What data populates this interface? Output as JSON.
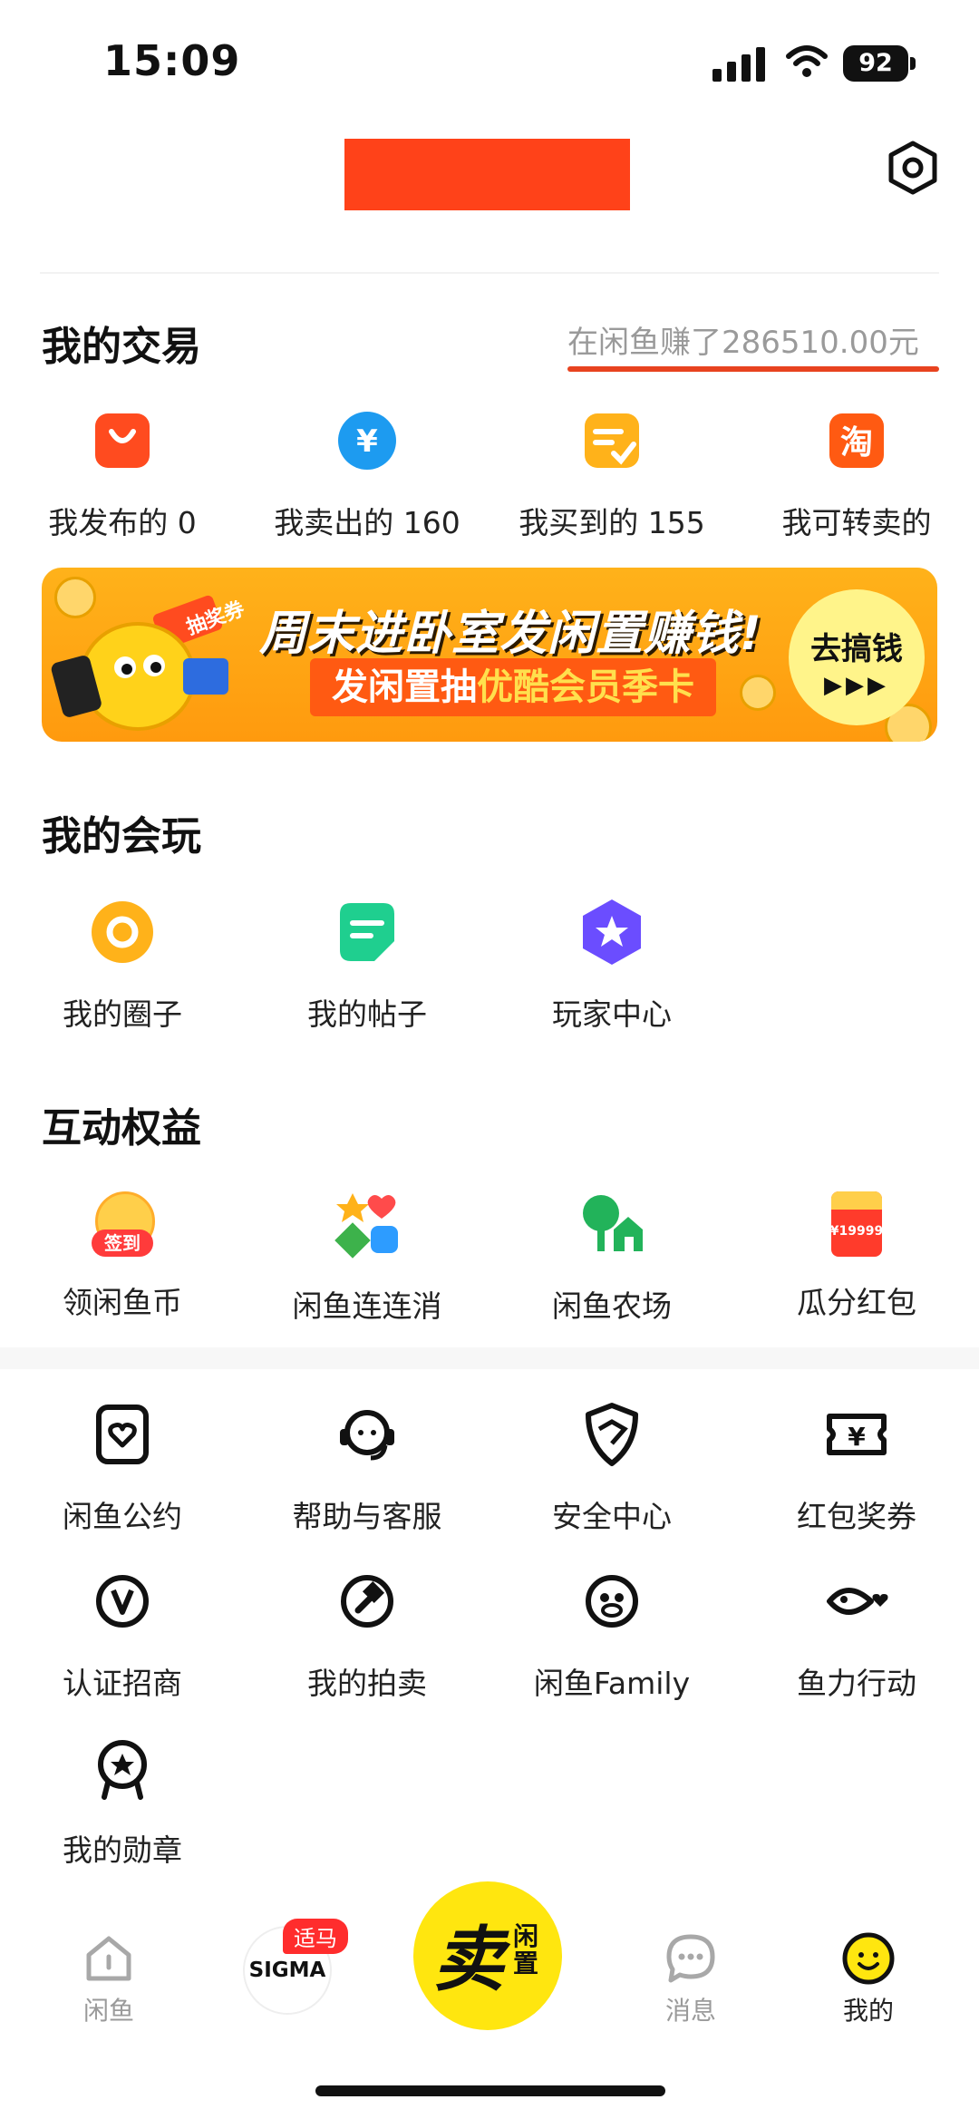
{
  "status_bar": {
    "time": "15:09",
    "battery": "92"
  },
  "settings_icon": "hexagon-settings-icon",
  "trade": {
    "title": "我的交易",
    "earned": "在闲鱼赚了286510.00元",
    "items": [
      {
        "label": "我发布的 0",
        "icon": "bag-icon",
        "color": "#ff4b1f"
      },
      {
        "label": "我卖出的 160",
        "icon": "yen-circle-icon",
        "color": "#1d9bf0"
      },
      {
        "label": "我买到的 155",
        "icon": "check-note-icon",
        "color": "#ffb21a"
      },
      {
        "label": "我可转卖的",
        "icon": "taobao-icon",
        "color": "#ff5a12"
      }
    ]
  },
  "banner": {
    "title": "周末进卧室发闲置赚钱!",
    "sub_prefix": "发闲置抽",
    "sub_highlight": "优酷会员季卡",
    "button_line1": "去搞钱",
    "button_line2": "▶▶▶",
    "ticket_text": "抽奖券"
  },
  "play": {
    "title": "我的会玩",
    "items": [
      {
        "label": "我的圈子",
        "icon": "circle-ring-icon",
        "color": "#ffb21a"
      },
      {
        "label": "我的帖子",
        "icon": "post-note-icon",
        "color": "#1fcf8f"
      },
      {
        "label": "玩家中心",
        "icon": "star-hexagon-icon",
        "color": "#6b4dff"
      }
    ]
  },
  "benefits": {
    "title": "互动权益",
    "items": [
      {
        "label": "领闲鱼币",
        "icon": "sign-in-coin-icon",
        "badge": "签到"
      },
      {
        "label": "闲鱼连连消",
        "icon": "match-game-icon"
      },
      {
        "label": "闲鱼农场",
        "icon": "farm-tree-icon"
      },
      {
        "label": "瓜分红包",
        "icon": "red-packet-icon",
        "badge": "¥19999"
      }
    ]
  },
  "tools": [
    {
      "label": "闲鱼公约",
      "icon": "heart-doc-icon"
    },
    {
      "label": "帮助与客服",
      "icon": "headset-icon"
    },
    {
      "label": "安全中心",
      "icon": "shield-icon"
    },
    {
      "label": "红包奖券",
      "icon": "yen-ticket-icon"
    },
    {
      "label": "认证招商",
      "icon": "v-badge-icon"
    },
    {
      "label": "我的拍卖",
      "icon": "auction-hammer-icon"
    },
    {
      "label": "闲鱼Family",
      "icon": "monkey-face-icon"
    },
    {
      "label": "鱼力行动",
      "icon": "fish-heart-icon"
    },
    {
      "label": "我的勋章",
      "icon": "medal-icon"
    }
  ],
  "nav": {
    "home": "闲鱼",
    "sigma": "SIGMA",
    "sigma_badge": "适马",
    "sell_big": "卖",
    "sell_small": "闲置",
    "messages": "消息",
    "me": "我的"
  }
}
